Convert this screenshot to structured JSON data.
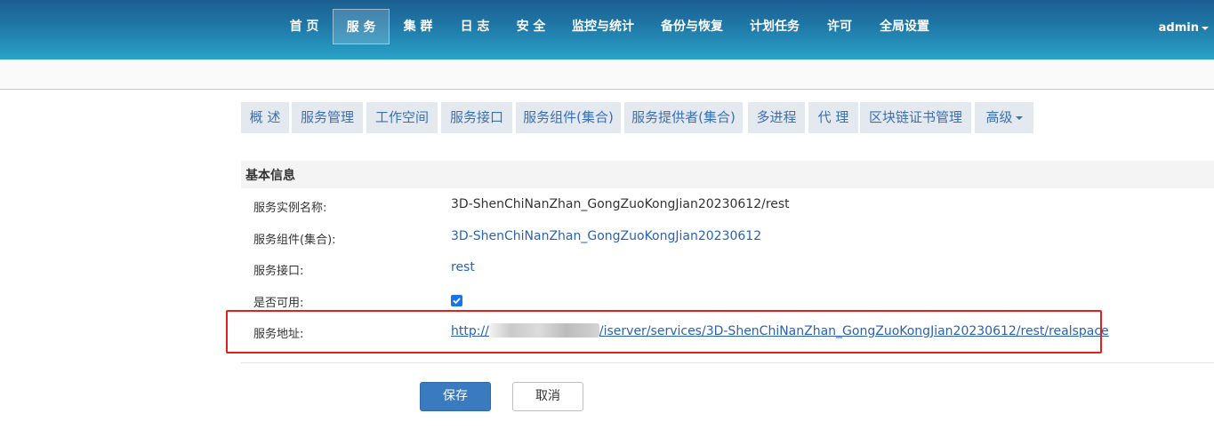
{
  "nav": {
    "items": [
      "首 页",
      "服 务",
      "集 群",
      "日 志",
      "安 全",
      "监控与统计",
      "备份与恢复",
      "计划任务",
      "许可",
      "全局设置"
    ],
    "active": "服 务",
    "user": "admin"
  },
  "tabs": [
    "概 述",
    "服务管理",
    "工作空间",
    "服务接口",
    "服务组件(集合)",
    "服务提供者(集合)",
    "多进程",
    "代 理",
    "区块链证书管理",
    "高级"
  ],
  "info": {
    "title": "基本信息",
    "rows": [
      {
        "label": "服务实例名称:",
        "value": "3D-ShenChiNanZhan_GongZuoKongJian20230612/rest"
      },
      {
        "label": "服务组件(集合):",
        "value": "3D-ShenChiNanZhan_GongZuoKongJian20230612"
      },
      {
        "label": "服务接口:",
        "value": "rest"
      },
      {
        "label": "是否可用:",
        "value": true
      },
      {
        "label": "服务地址:",
        "value_prefix": "http://",
        "value_suffix": "/iserver/services/3D-ShenChiNanZhan_GongZuoKongJian20230612/rest/realspace"
      }
    ]
  },
  "buttons": {
    "save": "保存",
    "cancel": "取消"
  },
  "colors": {
    "accent": "#3a7bc0",
    "highlight": "#e0221c",
    "link": "#2a62b3"
  }
}
